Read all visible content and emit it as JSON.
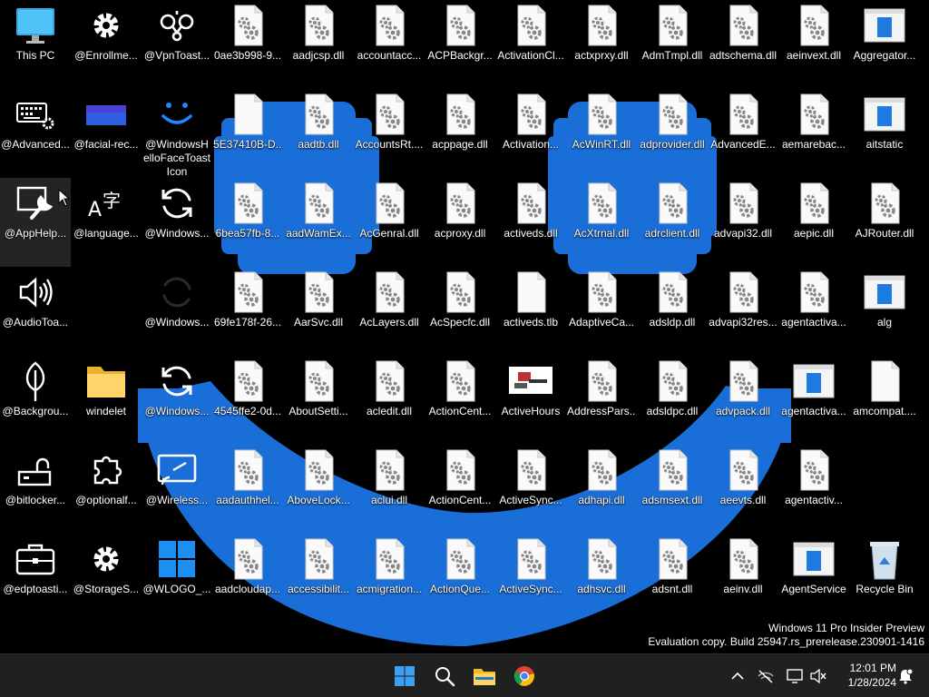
{
  "desktop": {
    "columns": 13,
    "rows": [
      [
        [
          "This PC",
          "monitor"
        ],
        [
          "@Enrollme...",
          "gear"
        ],
        [
          "@VpnToast...",
          "vpn"
        ],
        [
          "0ae3b998-9...",
          "gearfile"
        ],
        [
          "aadjcsp.dll",
          "gearfile"
        ],
        [
          "accountacc...",
          "gearfile"
        ],
        [
          "ACPBackgr...",
          "gearfile"
        ],
        [
          "ActivationCl...",
          "gearfile"
        ],
        [
          "actxprxy.dll",
          "gearfile"
        ],
        [
          "AdmTmpl.dll",
          "gearfile"
        ],
        [
          "adtschema.dll",
          "gearfile"
        ],
        [
          "aeinvext.dll",
          "gearfile"
        ],
        [
          "Aggregator...",
          "app"
        ]
      ],
      [
        [
          "@Advanced...",
          "keyboard"
        ],
        [
          "@facial-rec...",
          "bluebar"
        ],
        [
          "@WindowsHelloFaceToastIcon",
          "smile"
        ],
        [
          "5E37410B-D...",
          "blankfile"
        ],
        [
          "aadtb.dll",
          "gearfile"
        ],
        [
          "AccountsRt....",
          "gearfile"
        ],
        [
          "acppage.dll",
          "gearfile"
        ],
        [
          "Activation...",
          "gearfile"
        ],
        [
          "AcWinRT.dll",
          "gearfile"
        ],
        [
          "adprovider.dll",
          "gearfile"
        ],
        [
          "AdvancedE...",
          "gearfile"
        ],
        [
          "aemarebac...",
          "gearfile"
        ],
        [
          "aitstatic",
          "app"
        ]
      ],
      [
        [
          "@AppHelp...",
          "wrench"
        ],
        [
          "@language...",
          "lang"
        ],
        [
          "@Windows...",
          "sync"
        ],
        [
          "6bea57fb-8...",
          "gearfile"
        ],
        [
          "aadWamEx...",
          "gearfile"
        ],
        [
          "AcGenral.dll",
          "gearfile"
        ],
        [
          "acproxy.dll",
          "gearfile"
        ],
        [
          "activeds.dll",
          "gearfile"
        ],
        [
          "AcXtrnal.dll",
          "gearfile"
        ],
        [
          "adrclient.dll",
          "gearfile"
        ],
        [
          "advapi32.dll",
          "gearfile"
        ],
        [
          "aepic.dll",
          "gearfile"
        ],
        [
          "AJRouter.dll",
          "gearfile"
        ]
      ],
      [
        [
          "@AudioToa...",
          "speaker"
        ],
        null,
        [
          "@Windows...",
          "syncdim"
        ],
        [
          "69fe178f-26...",
          "gearfile"
        ],
        [
          "AarSvc.dll",
          "gearfile"
        ],
        [
          "AcLayers.dll",
          "gearfile"
        ],
        [
          "AcSpecfc.dll",
          "gearfile"
        ],
        [
          "activeds.tlb",
          "blankfile"
        ],
        [
          "AdaptiveCa...",
          "gearfile"
        ],
        [
          "adsldp.dll",
          "gearfile"
        ],
        [
          "advapi32res...",
          "gearfile"
        ],
        [
          "agentactiva...",
          "gearfile"
        ],
        [
          "alg",
          "app"
        ]
      ],
      [
        [
          "@Backgrou...",
          "leaf"
        ],
        [
          "windelet",
          "folder"
        ],
        [
          "@Windows...",
          "sync"
        ],
        [
          "4545ffe2-0d...",
          "gearfile"
        ],
        [
          "AboutSetti...",
          "gearfile"
        ],
        [
          "acledit.dll",
          "gearfile"
        ],
        [
          "ActionCent...",
          "gearfile"
        ],
        [
          "ActiveHours",
          "photo"
        ],
        [
          "AddressPars...",
          "gearfile"
        ],
        [
          "adsldpc.dll",
          "gearfile"
        ],
        [
          "advpack.dll",
          "gearfile"
        ],
        [
          "agentactiva...",
          "app"
        ],
        [
          "amcompat....",
          "blankfile"
        ]
      ],
      [
        [
          "@bitlocker...",
          "lock"
        ],
        [
          "@optionalf...",
          "puzzle"
        ],
        [
          "@Wireless...",
          "cast"
        ],
        [
          "aadauthhel...",
          "gearfile"
        ],
        [
          "AboveLock...",
          "gearfile"
        ],
        [
          "aclui.dll",
          "gearfile"
        ],
        [
          "ActionCent...",
          "gearfile"
        ],
        [
          "ActiveSync...",
          "gearfile"
        ],
        [
          "adhapi.dll",
          "gearfile"
        ],
        [
          "adsmsext.dll",
          "gearfile"
        ],
        [
          "aeevts.dll",
          "gearfile"
        ],
        [
          "agentactiv...",
          "gearfile"
        ],
        null
      ],
      [
        [
          "@edptoasti...",
          "briefcase"
        ],
        [
          "@StorageS...",
          "gear"
        ],
        [
          "@WLOGO_...",
          "winlogo"
        ],
        [
          "aadcloudap...",
          "gearfile"
        ],
        [
          "accessibilit...",
          "gearfile"
        ],
        [
          "acmigration...",
          "gearfile"
        ],
        [
          "ActionQue...",
          "gearfile"
        ],
        [
          "ActiveSync...",
          "gearfile"
        ],
        [
          "adhsvc.dll",
          "gearfile"
        ],
        [
          "adsnt.dll",
          "gearfile"
        ],
        [
          "aeinv.dll",
          "gearfile"
        ],
        [
          "AgentService",
          "app"
        ],
        [
          "Recycle Bin",
          "recycle"
        ]
      ]
    ]
  },
  "watermark": {
    "line1": "Windows 11 Pro Insider Preview",
    "line2": "Evaluation copy. Build 25947.rs_prerelease.230901-1416"
  },
  "taskbar": {
    "pinned": [
      {
        "name": "start-button",
        "icon": "start-icon"
      },
      {
        "name": "search-button",
        "icon": "search-icon"
      },
      {
        "name": "file-explorer-button",
        "icon": "folder-icon"
      },
      {
        "name": "chrome-button",
        "icon": "chrome-icon"
      }
    ],
    "tray": {
      "icons": [
        "chevron-up-icon",
        "network-off-icon",
        "display-icon",
        "volume-muted-icon",
        "notification-icon"
      ]
    },
    "clock": {
      "time": "12:01 PM",
      "date": "1/28/2024"
    }
  },
  "colors": {
    "wallpaper_blue": "#1a6ed8",
    "taskbar_bg": "#202020",
    "accent": "#0078d4"
  }
}
